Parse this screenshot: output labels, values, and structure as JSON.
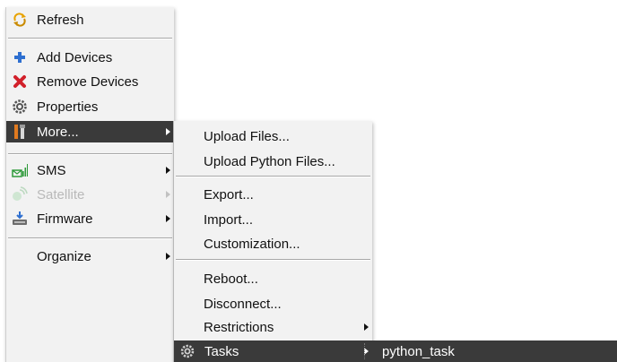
{
  "menu": {
    "items": [
      {
        "label": "Refresh",
        "icon": "refresh-icon"
      },
      {
        "label": "Add Devices",
        "icon": "plus-icon"
      },
      {
        "label": "Remove Devices",
        "icon": "red-x-icon"
      },
      {
        "label": "Properties",
        "icon": "gear-icon"
      },
      {
        "label": "More...",
        "icon": "tools-icon",
        "selected": true
      },
      {
        "label": "SMS",
        "icon": "sms-icon"
      },
      {
        "label": "Satellite",
        "icon": "satellite-icon",
        "disabled": true
      },
      {
        "label": "Firmware",
        "icon": "firmware-icon"
      },
      {
        "label": "Organize"
      }
    ]
  },
  "submenu_more": {
    "items": [
      {
        "label": "Upload Files..."
      },
      {
        "label": "Upload Python Files..."
      },
      {
        "label": "Export..."
      },
      {
        "label": "Import..."
      },
      {
        "label": "Customization..."
      },
      {
        "label": "Reboot..."
      },
      {
        "label": "Disconnect..."
      },
      {
        "label": "Restrictions"
      },
      {
        "label": "Tasks",
        "icon": "gear-icon",
        "selected": true
      }
    ]
  },
  "submenu_tasks": {
    "items": [
      {
        "label": "python_task"
      }
    ]
  },
  "colors": {
    "menu_bg": "#f2f2f2",
    "highlight": "#3a3a3a",
    "disabled_text": "#b9b9b9"
  }
}
